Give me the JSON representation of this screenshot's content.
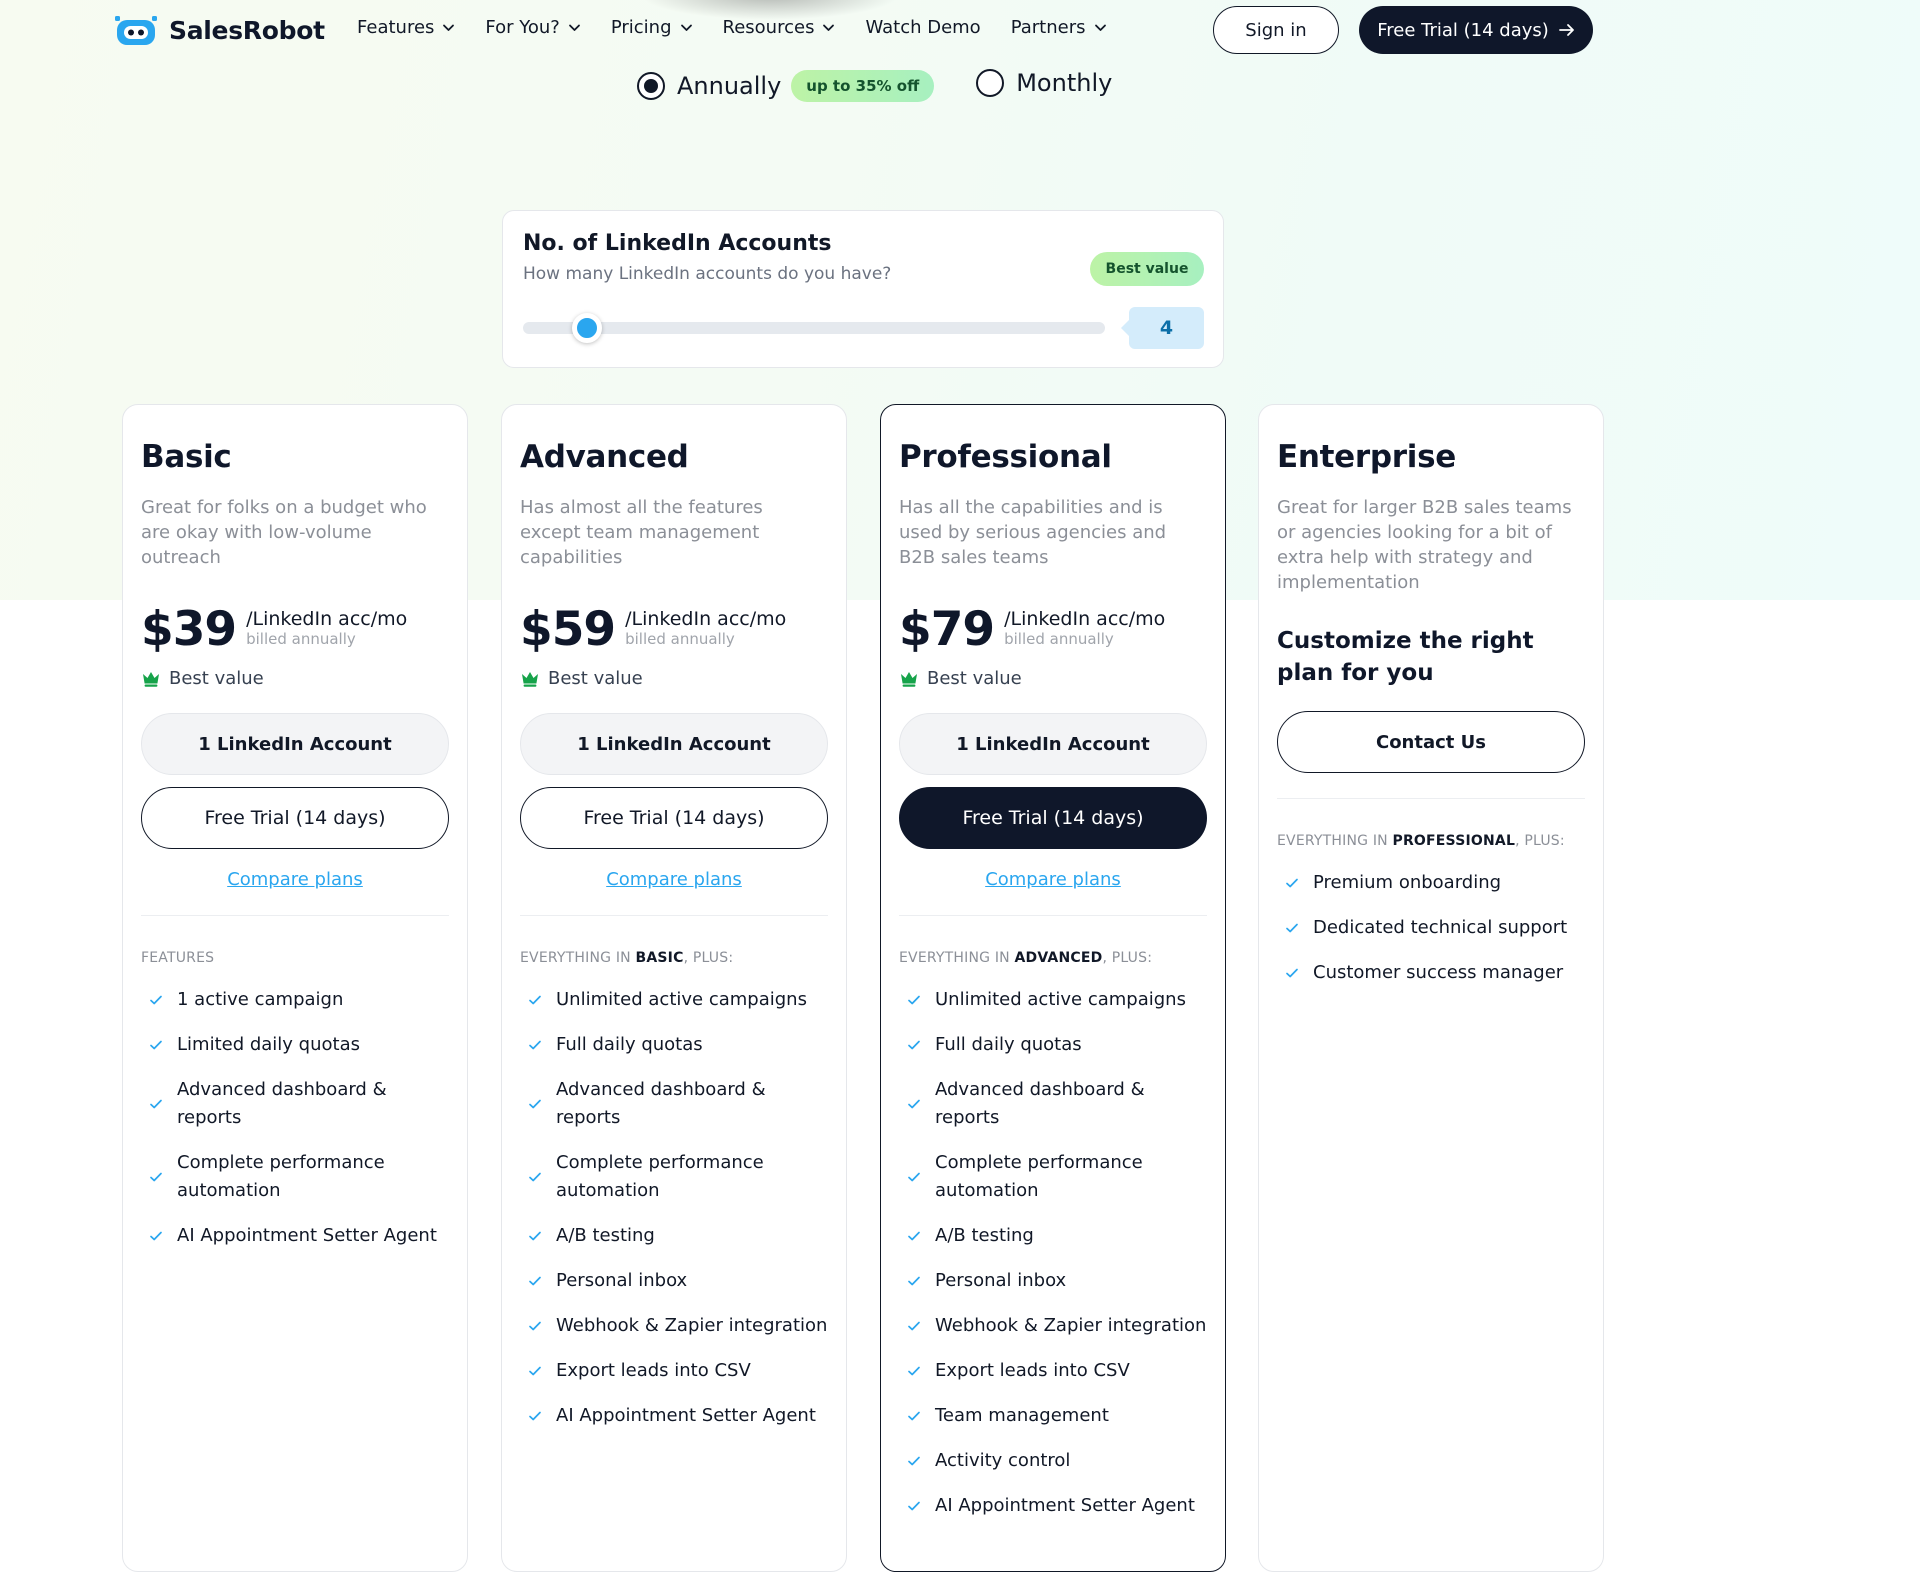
{
  "brand": {
    "name": "SalesRobot",
    "accent": "#2aa6ef",
    "dark": "#0f172a"
  },
  "nav": {
    "links": [
      {
        "label": "Features",
        "dropdown": true
      },
      {
        "label": "For You?",
        "dropdown": true
      },
      {
        "label": "Pricing",
        "dropdown": true
      },
      {
        "label": "Resources",
        "dropdown": true
      },
      {
        "label": "Watch Demo",
        "dropdown": false
      },
      {
        "label": "Partners",
        "dropdown": true
      }
    ],
    "signin": "Sign in",
    "trial": "Free Trial (14 days)"
  },
  "billing": {
    "annually": "Annually",
    "discount": "up to 35% off",
    "monthly": "Monthly",
    "selected": "annually"
  },
  "slider": {
    "title": "No. of LinkedIn Accounts",
    "subtitle": "How many LinkedIn accounts do you have?",
    "badge": "Best value",
    "value": "4",
    "position_fraction": 0.11
  },
  "plans": [
    {
      "name": "Basic",
      "desc": "Great for folks on a budget who are okay with low-volume outreach",
      "price": "$39",
      "unit": "/LinkedIn acc/mo",
      "billed": "billed annually",
      "best": "Best value",
      "accounts": "1 LinkedIn Account",
      "trial": "Free Trial (14 days)",
      "compare": "Compare plans",
      "features_head": "FEATURES",
      "features": [
        "1 active campaign",
        "Limited daily quotas",
        "Advanced dashboard & reports",
        "Complete performance automation",
        "AI Appointment Setter Agent"
      ]
    },
    {
      "name": "Advanced",
      "desc": "Has almost all the features except team management capabilities",
      "price": "$59",
      "unit": "/LinkedIn acc/mo",
      "billed": "billed annually",
      "best": "Best value",
      "accounts": "1 LinkedIn Account",
      "trial": "Free Trial (14 days)",
      "compare": "Compare plans",
      "head_pre": "EVERYTHING IN ",
      "head_bold": "BASIC",
      "head_post": ", PLUS:",
      "features": [
        "Unlimited active campaigns",
        "Full daily quotas",
        "Advanced dashboard & reports",
        "Complete performance automation",
        "A/B testing",
        "Personal inbox",
        "Webhook & Zapier integration",
        "Export leads into CSV",
        "AI Appointment Setter Agent"
      ]
    },
    {
      "name": "Professional",
      "desc": "Has all the capabilities and is used by serious agencies and B2B sales teams",
      "price": "$79",
      "unit": "/LinkedIn acc/mo",
      "billed": "billed annually",
      "best": "Best value",
      "accounts": "1 LinkedIn Account",
      "trial": "Free Trial (14 days)",
      "compare": "Compare plans",
      "head_pre": "EVERYTHING IN ",
      "head_bold": "ADVANCED",
      "head_post": ", PLUS:",
      "features": [
        "Unlimited active campaigns",
        "Full daily quotas",
        "Advanced dashboard & reports",
        "Complete performance automation",
        "A/B testing",
        "Personal inbox",
        "Webhook & Zapier integration",
        "Export leads into CSV",
        "Team management",
        "Activity control",
        "AI Appointment Setter Agent"
      ]
    },
    {
      "name": "Enterprise",
      "desc": "Great for larger B2B sales teams or agencies looking for a bit of extra help with strategy and implementation",
      "custom": "Customize the right plan for you",
      "contact": "Contact Us",
      "head_pre": "EVERYTHING IN ",
      "head_bold": "PROFESSIONAL",
      "head_post": ", PLUS:",
      "features": [
        "Premium onboarding",
        "Dedicated technical support",
        "Customer success manager"
      ]
    }
  ]
}
